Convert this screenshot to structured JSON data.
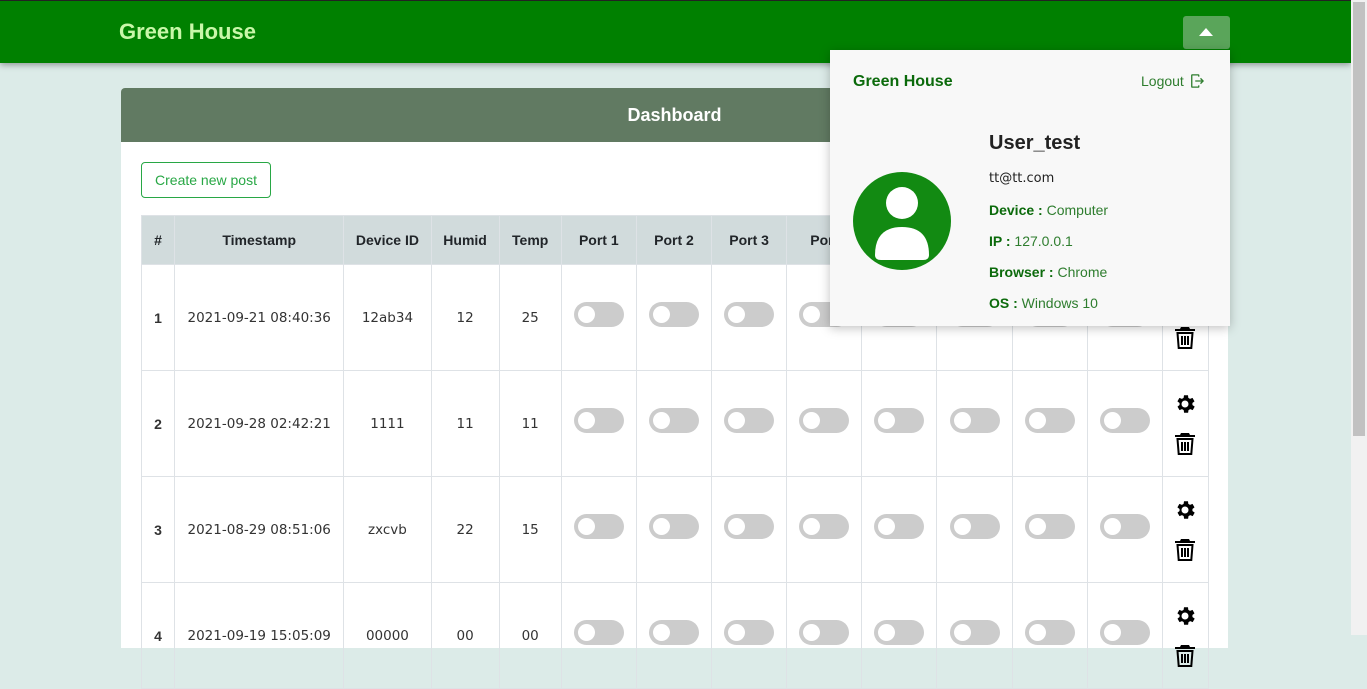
{
  "app": {
    "brand": "Green House"
  },
  "card": {
    "title": "Dashboard",
    "create_label": "Create new post"
  },
  "table": {
    "headers": [
      "#",
      "Timestamp",
      "Device ID",
      "Humid",
      "Temp",
      "Port 1",
      "Port 2",
      "Port 3",
      "Port"
    ],
    "rows": [
      {
        "num": "1",
        "timestamp": "2021-09-21 08:40:36",
        "device": "12ab34",
        "humid": "12",
        "temp": "25"
      },
      {
        "num": "2",
        "timestamp": "2021-09-28 02:42:21",
        "device": "1111",
        "humid": "11",
        "temp": "11"
      },
      {
        "num": "3",
        "timestamp": "2021-08-29 08:51:06",
        "device": "zxcvb",
        "humid": "22",
        "temp": "15"
      },
      {
        "num": "4",
        "timestamp": "2021-09-19 15:05:09",
        "device": "00000",
        "humid": "00",
        "temp": "00"
      }
    ]
  },
  "popover": {
    "brand": "Green House",
    "logout": "Logout",
    "user_name": "User_test",
    "email": "tt@tt.com",
    "device_label": "Device :",
    "device_value": "Computer",
    "ip_label": "IP :",
    "ip_value": "127.0.0.1",
    "browser_label": "Browser :",
    "browser_value": "Chrome",
    "os_label": "OS :",
    "os_value": "Windows 10"
  },
  "icons": {
    "toggle": "caret-up-icon",
    "settings": "gear-icon",
    "delete": "trash-icon",
    "logout": "logout-icon",
    "avatar": "user-avatar-icon"
  },
  "colors": {
    "navbar": "#008000",
    "header": "#617a62",
    "accent": "#28a745",
    "switch_off": "#cccccc"
  }
}
